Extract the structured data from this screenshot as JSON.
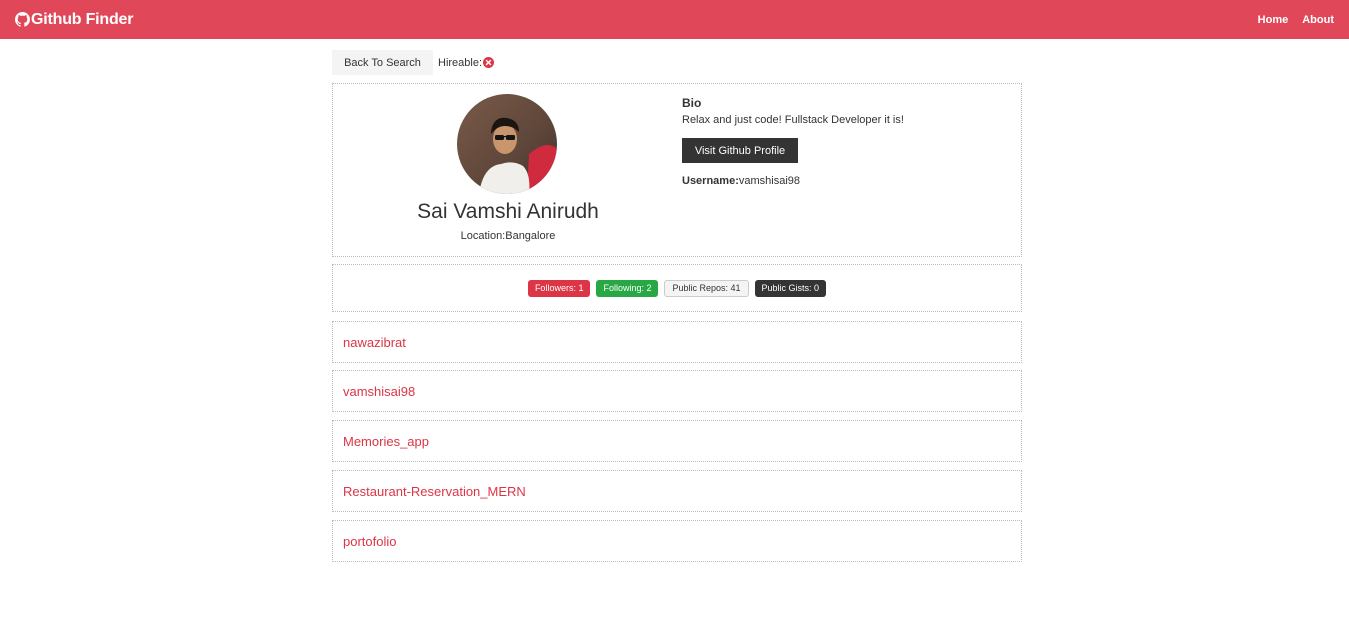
{
  "navbar": {
    "brand": "Github Finder",
    "links": [
      "Home",
      "About"
    ]
  },
  "top": {
    "back_label": "Back To Search",
    "hireable_label": "Hireable:"
  },
  "profile": {
    "name": "Sai Vamshi Anirudh",
    "location": "Location:Bangalore",
    "bio_title": "Bio",
    "bio_text": "Relax and just code! Fullstack Developer it is!",
    "visit_label": "Visit Github Profile",
    "username_label": "Username:",
    "username_value": "vamshisai98"
  },
  "stats": {
    "followers": "Followers: 1",
    "following": "Following: 2",
    "public_repos": "Public Repos: 41",
    "public_gists": "Public Gists: 0"
  },
  "repos": [
    "nawazibrat",
    "vamshisai98",
    "Memories_app",
    "Restaurant-Reservation_MERN",
    "portofolio"
  ],
  "colors": {
    "brand": "#e0485a",
    "danger": "#dc3545",
    "success": "#28a745",
    "dark": "#343434",
    "light": "#f4f4f4"
  },
  "icons": {
    "brand_icon": "github-icon",
    "hireable_icon": "times-circle-icon"
  }
}
